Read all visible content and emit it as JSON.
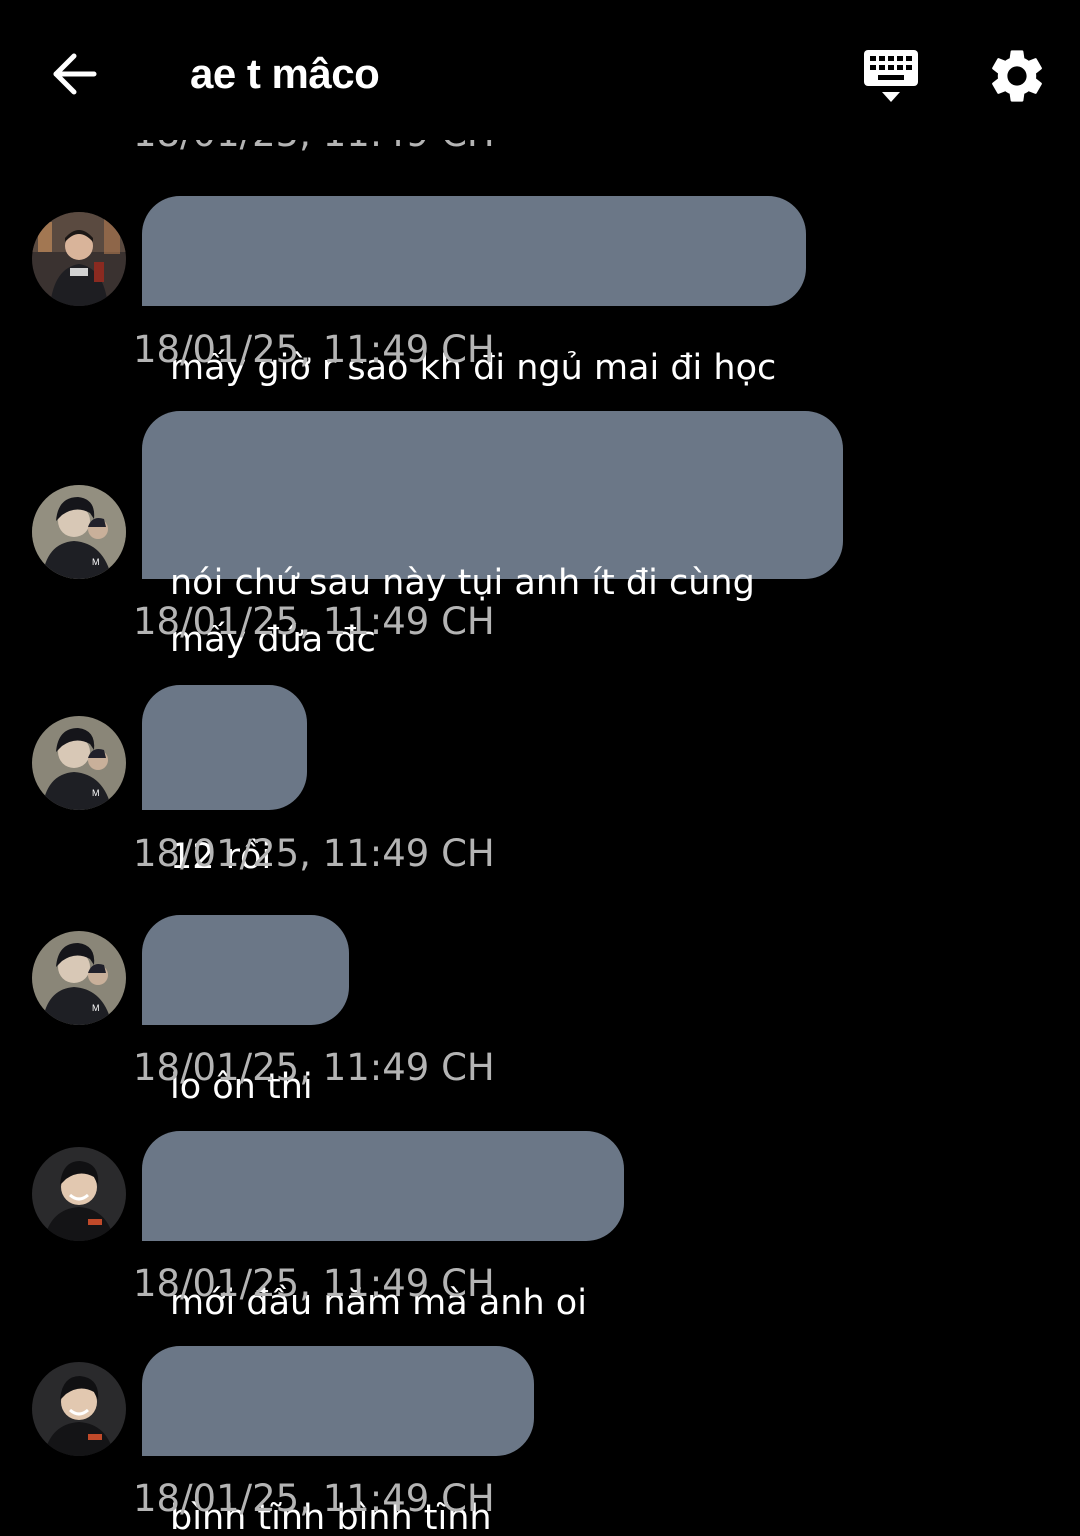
{
  "header": {
    "title": "ae t mâco",
    "back_icon": "arrow-left-icon",
    "keyboard_icon": "keyboard-hide-icon",
    "settings_icon": "gear-icon"
  },
  "colors": {
    "background": "#000000",
    "bubble": "#6b7787",
    "timestamp": "#b4b4b4",
    "text": "#ffffff"
  },
  "previous_timestamp": "18/01/25, 11:49 CH",
  "messages": [
    {
      "text": "mấy giờ r sao kh đi ngủ mai đi học",
      "timestamp": "18/01/25, 11:49 CH",
      "avatar": "avatar-user-1"
    },
    {
      "text": "nói chứ sau này tụi anh ít đi cùng\nmấy đứa đc",
      "timestamp": "18/01/25, 11:49 CH",
      "avatar": "avatar-user-2"
    },
    {
      "text": "12 rồi",
      "timestamp": "18/01/25, 11:49 CH",
      "avatar": "avatar-user-2"
    },
    {
      "text": "lo ôn thi",
      "timestamp": "18/01/25, 11:49 CH",
      "avatar": "avatar-user-2"
    },
    {
      "text": "mới đầu năm mà anh oi",
      "timestamp": "18/01/25, 11:49 CH",
      "avatar": "avatar-user-3"
    },
    {
      "text": "bình tĩnh bình tĩnh",
      "timestamp": "18/01/25, 11:49 CH",
      "avatar": "avatar-user-3"
    }
  ]
}
